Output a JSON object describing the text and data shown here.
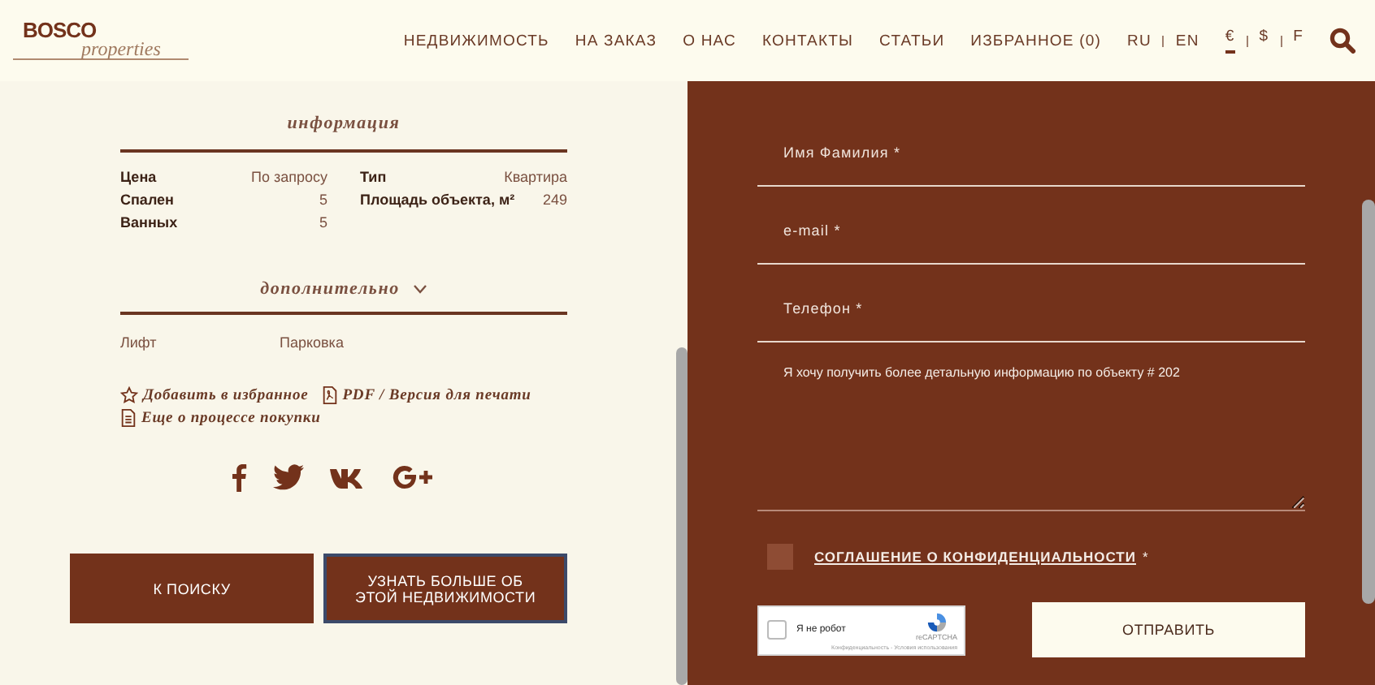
{
  "header": {
    "logo": {
      "word": "BOSCO",
      "script": "properties"
    },
    "nav": [
      "НЕДВИЖИМОСТЬ",
      "НА ЗАКАЗ",
      "О НАС",
      "КОНТАКТЫ",
      "СТАТЬИ",
      "ИЗБРАННОЕ (0)"
    ],
    "languages": [
      "RU",
      "EN"
    ],
    "currencies": [
      {
        "label": "€",
        "selected": true
      },
      {
        "label": "$",
        "selected": false
      },
      {
        "label": "F",
        "selected": false
      }
    ]
  },
  "info": {
    "title": "информация",
    "left": [
      {
        "label": "Цена",
        "value": "По запросу"
      },
      {
        "label": "Спален",
        "value": "5"
      },
      {
        "label": "Ванных",
        "value": "5"
      }
    ],
    "right": [
      {
        "label": "Тип",
        "value": "Квартира"
      },
      {
        "label": "Площадь объекта, м²",
        "value": "249"
      }
    ]
  },
  "extra": {
    "title": "дополнительно",
    "expanded": true,
    "features": [
      "Лифт",
      "Парковка"
    ]
  },
  "actions": [
    {
      "kind": "star",
      "label": "Добавить в избранное"
    },
    {
      "kind": "pdf",
      "label": "PDF / Версия для печати"
    },
    {
      "kind": "doc",
      "label": "Еще о процессе покупки"
    }
  ],
  "social": [
    {
      "kind": "facebook"
    },
    {
      "kind": "twitter"
    },
    {
      "kind": "vk"
    },
    {
      "kind": "googleplus"
    }
  ],
  "buttons": [
    "К ПОИСКУ",
    "УЗНАТЬ БОЛЬШЕ ОБ ЭТОЙ НЕДВИЖИМОСТИ"
  ],
  "form": {
    "fields": [
      {
        "placeholder": "Имя Фамилия *"
      },
      {
        "placeholder": "e-mail *"
      },
      {
        "placeholder": "Телефон *"
      }
    ],
    "message": "Я хочу получить более детальную информацию по объекту # 202",
    "agreement": {
      "checked": false,
      "link": "СОГЛАШЕНИЕ О КОНФИДЕНЦИАЛЬНОСТИ",
      "suffix": "*"
    },
    "captcha": {
      "label": "Я не робот",
      "brand": "reCAPTCHA",
      "terms": "Конфиденциальность - Условия использования",
      "checked": false
    },
    "submit": "ОТПРАВИТЬ"
  }
}
